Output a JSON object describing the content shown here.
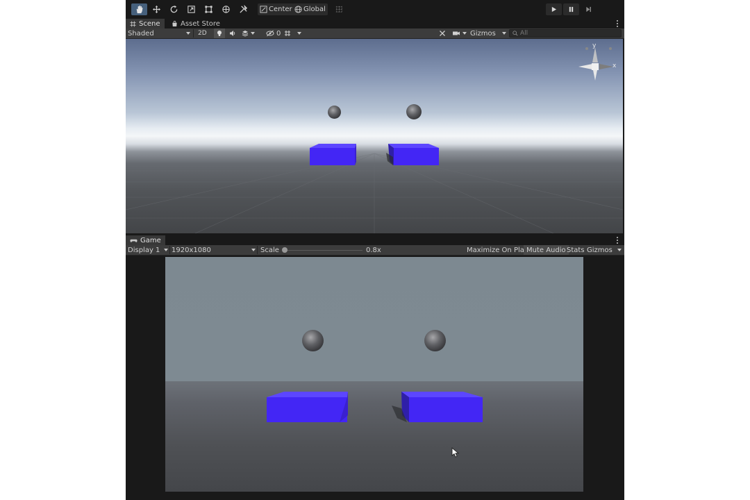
{
  "toolbar": {
    "tools": [
      {
        "name": "hand-tool",
        "icon": "hand-icon",
        "active": true
      },
      {
        "name": "move-tool",
        "icon": "move-icon"
      },
      {
        "name": "rotate-tool",
        "icon": "rotate-icon"
      },
      {
        "name": "scale-tool",
        "icon": "scale-icon"
      },
      {
        "name": "rect-tool",
        "icon": "rect-icon"
      },
      {
        "name": "transform-tool",
        "icon": "transform-icon"
      },
      {
        "name": "custom-tool",
        "icon": "tools-icon"
      }
    ],
    "pivot_label": "Center",
    "space_label": "Global",
    "play_controls": [
      "play-icon",
      "pause-icon",
      "step-icon"
    ]
  },
  "scene_panel": {
    "tabs": [
      {
        "label": "Scene",
        "icon": "scene-grid-icon",
        "active": true
      },
      {
        "label": "Asset Store",
        "icon": "asset-store-icon",
        "active": false
      }
    ],
    "toolbar": {
      "shading_mode": "Shaded",
      "mode_2d_label": "2D",
      "hidden_objects_count": "0",
      "gizmos_label": "Gizmos",
      "search_placeholder": "All"
    },
    "orientation_gizmo": {
      "y_label": "y",
      "x_label": "x",
      "projection": "Persp"
    }
  },
  "game_panel": {
    "tab": {
      "label": "Game",
      "icon": "game-controller-icon"
    },
    "toolbar": {
      "display": "Display 1",
      "resolution": "1920x1080",
      "scale_label": "Scale",
      "scale_value": "0.8x",
      "scale_fraction": 0.02,
      "maximize_label": "Maximize On Play",
      "mute_label": "Mute Audio",
      "stats_label": "Stats",
      "gizmos_label": "Gizmos"
    }
  },
  "colors": {
    "editor_bg": "#191919",
    "toolbar_bg": "#3c3c3c",
    "active_tool": "#46607c",
    "cube_blue": "#4326f5"
  }
}
